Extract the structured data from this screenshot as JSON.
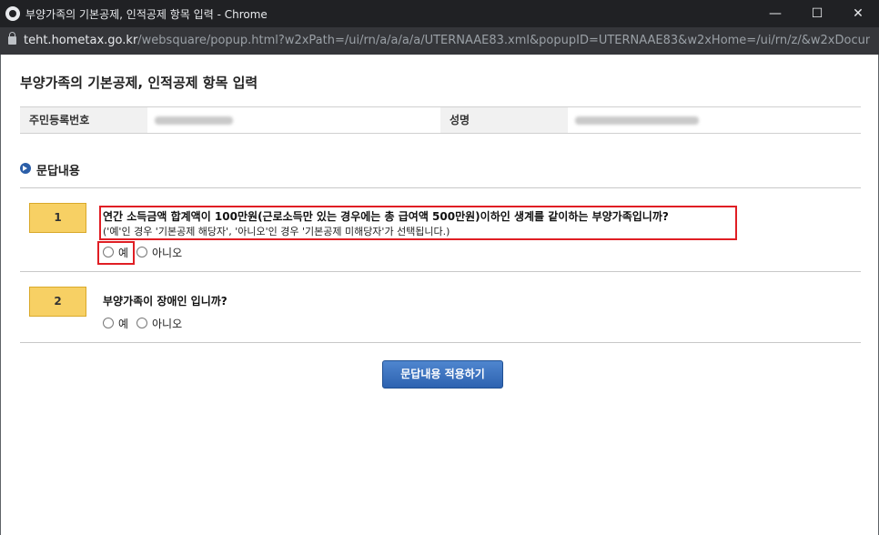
{
  "window": {
    "title": "부양가족의 기본공제, 인적공제 항목 입력 - Chrome",
    "minimize_glyph": "—",
    "maximize_glyph": "☐",
    "close_glyph": "✕"
  },
  "address_bar": {
    "host": "teht.hometax.go.kr",
    "path": "/websquare/popup.html?w2xPath=/ui/rn/a/a/a/a/UTERNAAE83.xml&popupID=UTERNAAE83&w2xHome=/ui/rn/z/&w2xDocumen..."
  },
  "page": {
    "title": "부양가족의 기본공제, 인적공제 항목 입력"
  },
  "info": {
    "resident_number_label": "주민등록번호",
    "name_label": "성명"
  },
  "section": {
    "title": "문답내용"
  },
  "questions": [
    {
      "number": "1",
      "text": "연간 소득금액 합계액이 100만원(근로소득만 있는 경우에는 총 급여액 500만원)이하인 생계를 같이하는 부양가족입니까?",
      "note": "('예'인 경우 '기본공제 해당자', '아니오'인 경우 '기본공제 미해당자'가 선택됩니다.)",
      "options": [
        "예",
        "아니오"
      ]
    },
    {
      "number": "2",
      "text": "부양가족이 장애인 입니까?",
      "options": [
        "예",
        "아니오"
      ]
    }
  ],
  "actions": {
    "apply_label": "문답내용 적용하기"
  },
  "colors": {
    "accent_blue": "#2d62b0",
    "highlight_red": "#e01e24",
    "number_badge": "#f7d064"
  }
}
